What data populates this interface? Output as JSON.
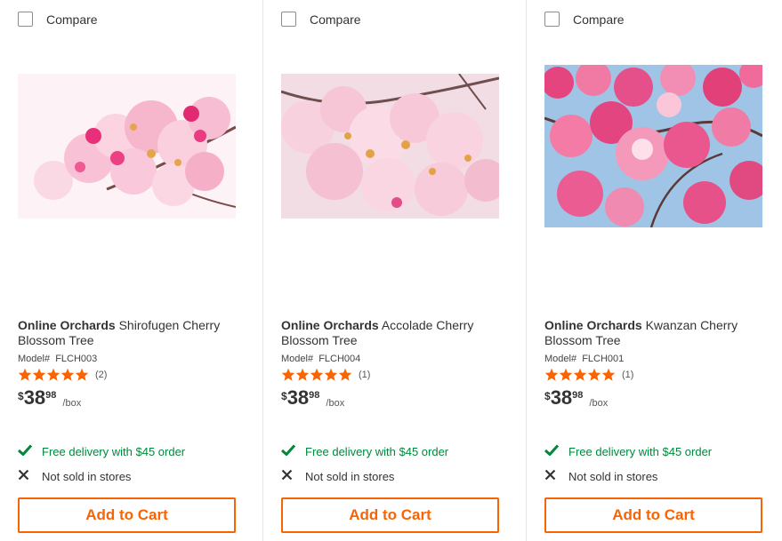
{
  "colors": {
    "accent": "#f96302",
    "delivery_green": "#00873c",
    "star": "#f96302"
  },
  "products": [
    {
      "compare_label": "Compare",
      "brand": "Online Orchards",
      "name": "Shirofugen Cherry Blossom Tree",
      "model_label": "Model#",
      "model": "FLCH003",
      "rating": 5,
      "review_count": "(2)",
      "price_currency": "$",
      "price_dollars": "38",
      "price_cents": "98",
      "price_unit": "/box",
      "delivery": "Free delivery with $45 order",
      "stores": "Not sold in stores",
      "add_to_cart": "Add to Cart",
      "image_icon": "cherry-blossom-photo"
    },
    {
      "compare_label": "Compare",
      "brand": "Online Orchards",
      "name": "Accolade Cherry Blossom Tree",
      "model_label": "Model#",
      "model": "FLCH004",
      "rating": 5,
      "review_count": "(1)",
      "price_currency": "$",
      "price_dollars": "38",
      "price_cents": "98",
      "price_unit": "/box",
      "delivery": "Free delivery with $45 order",
      "stores": "Not sold in stores",
      "add_to_cart": "Add to Cart",
      "image_icon": "cherry-blossom-photo"
    },
    {
      "compare_label": "Compare",
      "brand": "Online Orchards",
      "name": "Kwanzan Cherry Blossom Tree",
      "model_label": "Model#",
      "model": "FLCH001",
      "rating": 5,
      "review_count": "(1)",
      "price_currency": "$",
      "price_dollars": "38",
      "price_cents": "98",
      "price_unit": "/box",
      "delivery": "Free delivery with $45 order",
      "stores": "Not sold in stores",
      "add_to_cart": "Add to Cart",
      "image_icon": "cherry-blossom-photo"
    }
  ]
}
